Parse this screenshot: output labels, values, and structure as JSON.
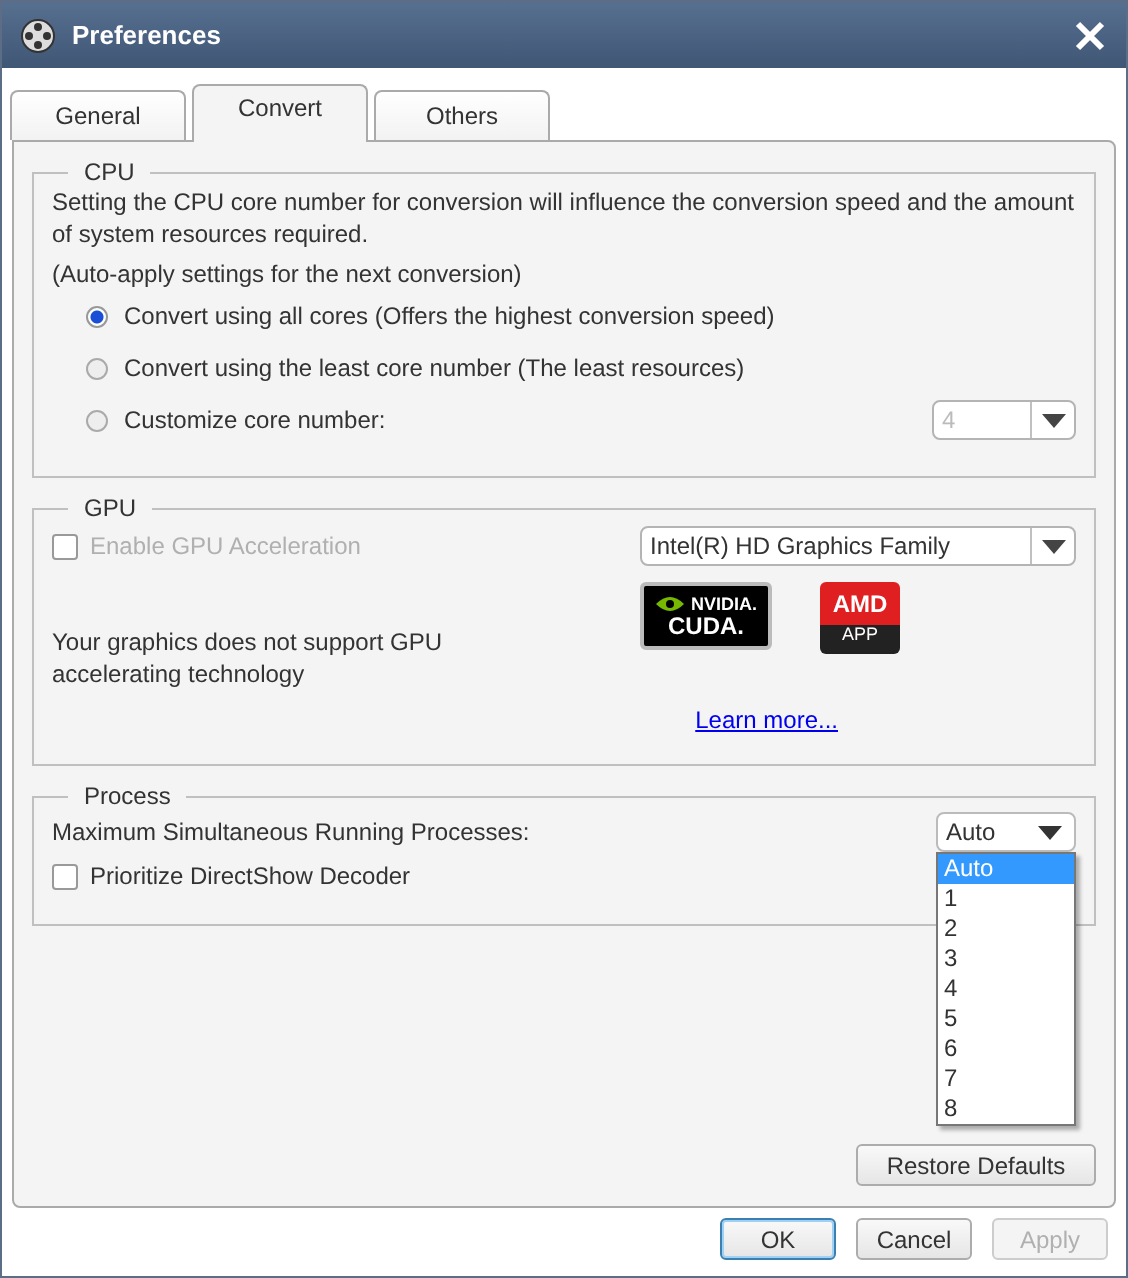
{
  "window": {
    "title": "Preferences"
  },
  "tabs": [
    {
      "label": "General",
      "selected": false
    },
    {
      "label": "Convert",
      "selected": true
    },
    {
      "label": "Others",
      "selected": false
    }
  ],
  "cpu": {
    "legend": "CPU",
    "description": "Setting the CPU core number for conversion will influence the conversion speed and the amount of system resources required.",
    "note": "(Auto-apply settings for the next conversion)",
    "options": [
      {
        "label": "Convert using all cores (Offers the highest conversion speed)",
        "selected": true
      },
      {
        "label": "Convert using the least core number (The least resources)",
        "selected": false
      },
      {
        "label": "Customize core number:",
        "selected": false,
        "select": {
          "value": "4",
          "disabled": true
        }
      }
    ]
  },
  "gpu": {
    "legend": "GPU",
    "enable": {
      "label": "Enable GPU Acceleration",
      "checked": false,
      "disabled": true
    },
    "device_select": {
      "value": "Intel(R) HD Graphics Family"
    },
    "message": "Your graphics does not support GPU accelerating technology",
    "logos": [
      {
        "kind": "nvidia",
        "line1": "NVIDIA.",
        "line2": "CUDA."
      },
      {
        "kind": "amd",
        "line1": "AMD",
        "line2": "APP"
      }
    ],
    "link": "Learn more..."
  },
  "process": {
    "legend": "Process",
    "max_label": "Maximum Simultaneous Running Processes:",
    "max_select": {
      "value": "Auto",
      "expanded": true,
      "options": [
        {
          "label": "Auto",
          "selected": true
        },
        {
          "label": "1",
          "selected": false
        },
        {
          "label": "2",
          "selected": false
        },
        {
          "label": "3",
          "selected": false
        },
        {
          "label": "4",
          "selected": false
        },
        {
          "label": "5",
          "selected": false
        },
        {
          "label": "6",
          "selected": false
        },
        {
          "label": "7",
          "selected": false
        },
        {
          "label": "8",
          "selected": false
        }
      ]
    },
    "directshow": {
      "label": "Prioritize DirectShow Decoder",
      "checked": false
    }
  },
  "restore": "Restore Defaults",
  "buttons": [
    {
      "label": "OK",
      "default": true,
      "disabled": false
    },
    {
      "label": "Cancel",
      "default": false,
      "disabled": false
    },
    {
      "label": "Apply",
      "default": false,
      "disabled": true
    }
  ]
}
